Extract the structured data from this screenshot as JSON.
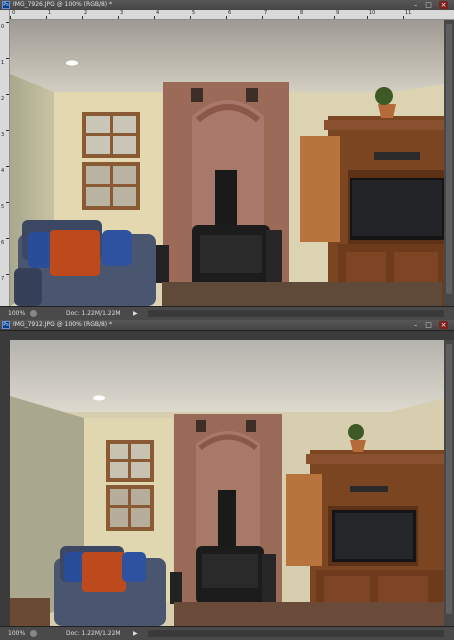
{
  "windows": [
    {
      "title": "IMG_7926.JPG @ 100% (RGB/8) *",
      "zoom": "100%",
      "doc_info": "Doc: 1.22M/1.22M",
      "top_ruler": [
        "0",
        "1",
        "2",
        "3",
        "4",
        "5",
        "6",
        "7",
        "8",
        "9",
        "10",
        "11"
      ],
      "left_ruler": [
        "0",
        "1",
        "2",
        "3",
        "4",
        "5",
        "6",
        "7"
      ],
      "window_controls": {
        "minimize": "–",
        "maximize": "□",
        "close": "×"
      }
    },
    {
      "title": "IMG_7912.JPG @ 100% (RGB/8) *",
      "zoom": "100%",
      "doc_info": "Doc: 1.22M/1.22M",
      "window_controls": {
        "minimize": "–",
        "maximize": "□",
        "close": "×"
      }
    }
  ],
  "icons": [
    "photoshop-document-icon",
    "minimize-icon",
    "maximize-icon",
    "close-icon",
    "status-menu-icon",
    "expand-arrow-icon"
  ]
}
